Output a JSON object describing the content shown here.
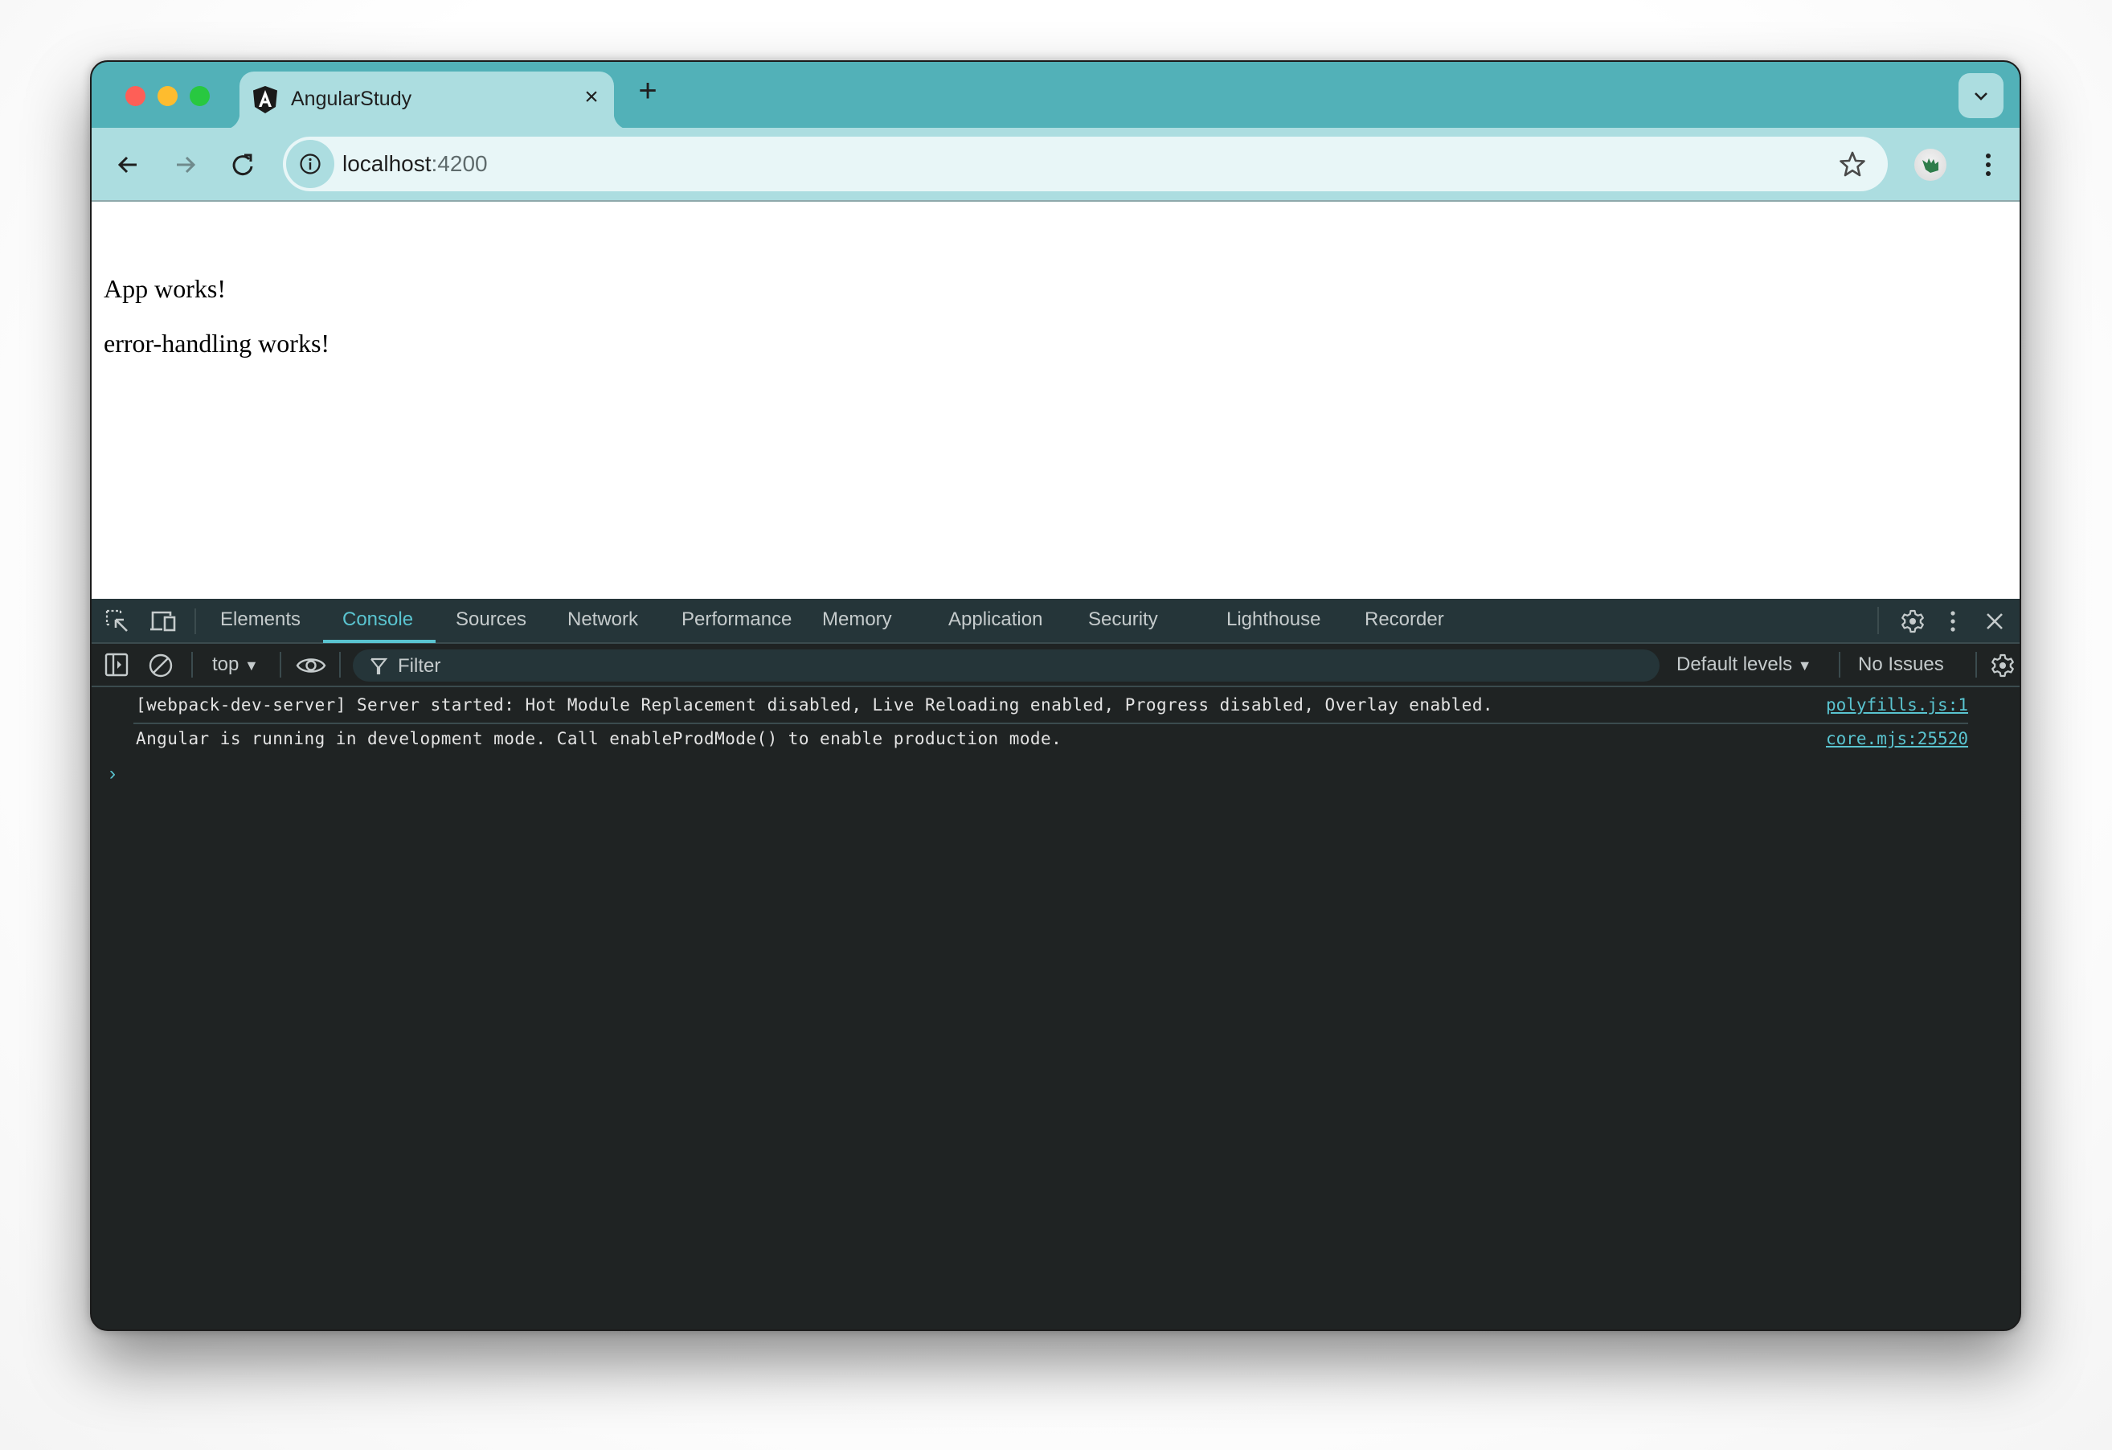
{
  "window": {
    "tab": {
      "title": "AngularStudy",
      "icon": "angular-icon",
      "close_glyph": "×"
    },
    "new_tab_glyph": "+",
    "address_bar": {
      "host": "localhost",
      "port": ":4200"
    }
  },
  "page": {
    "lines": [
      "App works!",
      "error-handling works!"
    ]
  },
  "devtools": {
    "tabs": [
      "Elements",
      "Console",
      "Sources",
      "Network",
      "Performance",
      "Memory",
      "Application",
      "Security",
      "Lighthouse",
      "Recorder"
    ],
    "active_tab": "Console",
    "console_toolbar": {
      "context": "top",
      "filter_placeholder": "Filter",
      "levels": "Default levels",
      "issues": "No Issues"
    },
    "messages": [
      {
        "text": "[webpack-dev-server] Server started: Hot Module Replacement disabled, Live Reloading enabled, Progress disabled, Overlay enabled.",
        "source": "polyfills.js:1"
      },
      {
        "text": "Angular is running in development mode. Call enableProdMode() to enable production mode.",
        "source": "core.mjs:25520"
      }
    ],
    "prompt_glyph": "›"
  },
  "colors": {
    "titlebar": "#52b1b8",
    "toolbar": "#acdde0",
    "devtools_accent": "#5ac4d0",
    "console_bg": "#1f2323"
  }
}
